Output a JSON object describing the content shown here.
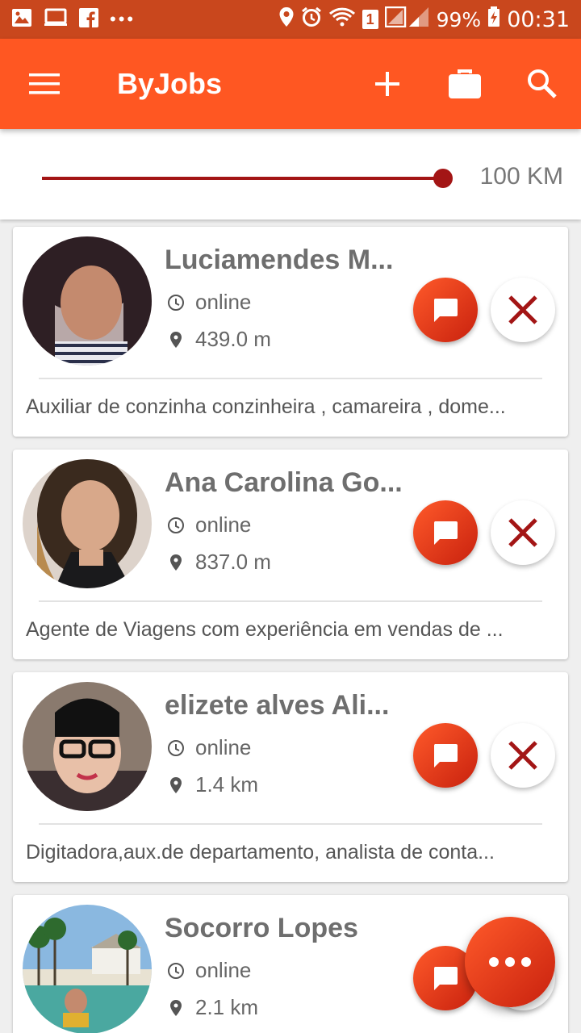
{
  "status_bar": {
    "left_icons": [
      "gallery-icon",
      "cast-icon",
      "facebook-icon",
      "more-notifications-icon"
    ],
    "sim_badge": "1",
    "battery": "99%",
    "time": "00:31"
  },
  "app_bar": {
    "title": "ByJobs",
    "actions": [
      "add-icon",
      "briefcase-icon",
      "search-icon"
    ]
  },
  "distance_filter": {
    "value_label": "100 KM",
    "level_fraction": 1.0
  },
  "candidates": [
    {
      "name": "Luciamendes M...",
      "status": "online",
      "distance": "439.0 m",
      "description": "Auxiliar de conzinha conzinheira , camareira , dome..."
    },
    {
      "name": "Ana Carolina Go...",
      "status": "online",
      "distance": "837.0 m",
      "description": "Agente de Viagens com experiência em vendas de ..."
    },
    {
      "name": "elizete alves Ali...",
      "status": "online",
      "distance": "1.4 km",
      "description": "Digitadora,aux.de departamento,  analista de conta..."
    },
    {
      "name": "Socorro Lopes",
      "status": "online",
      "distance": "2.1 km",
      "description": ""
    }
  ],
  "colors": {
    "status_bar": "#c9471d",
    "app_bar": "#ff5722",
    "accent": "#a31515",
    "button_gradient_start": "#ff5a2a",
    "button_gradient_end": "#c8210e"
  }
}
